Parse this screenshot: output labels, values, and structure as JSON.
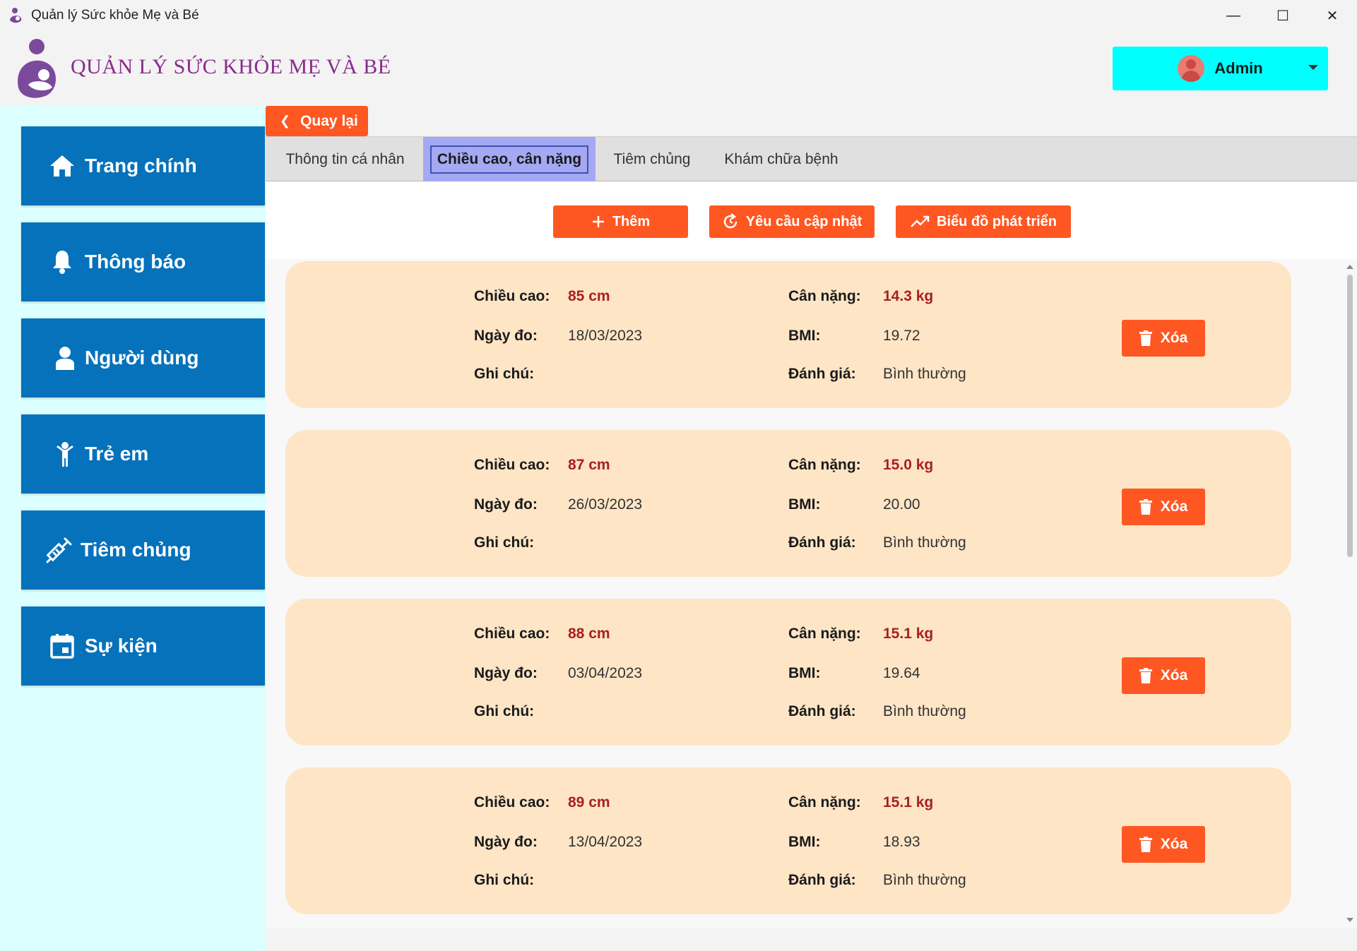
{
  "window": {
    "title": "Quản lý Sức khỏe Mẹ và Bé",
    "minimize": "—",
    "maximize": "☐",
    "close": "✕"
  },
  "header": {
    "brand": "QUẢN LÝ SỨC KHỎE MẸ VÀ BÉ",
    "user_name": "Admin"
  },
  "sidebar": {
    "items": [
      {
        "label": "Trang chính",
        "icon": "home-icon"
      },
      {
        "label": "Thông báo",
        "icon": "bell-icon"
      },
      {
        "label": "Người dùng",
        "icon": "user-icon"
      },
      {
        "label": "Trẻ em",
        "icon": "child-icon"
      },
      {
        "label": "Tiêm chủng",
        "icon": "syringe-icon"
      },
      {
        "label": "Sự kiện",
        "icon": "calendar-icon"
      }
    ]
  },
  "back_label": "Quay lại",
  "tabs": [
    {
      "label": "Thông tin cá nhân"
    },
    {
      "label": "Chiều cao, cân nặng"
    },
    {
      "label": "Tiêm chủng"
    },
    {
      "label": "Khám chữa bệnh"
    }
  ],
  "actions": {
    "add": "Thêm",
    "request_update": "Yêu cầu cập nhật",
    "growth_chart": "Biểu đồ phát triển"
  },
  "labels": {
    "height": "Chiều cao:",
    "weight": "Cân nặng:",
    "date": "Ngày đo:",
    "bmi": "BMI:",
    "note": "Ghi chú:",
    "assessment": "Đánh giá:",
    "delete": "Xóa"
  },
  "records": [
    {
      "height": "85 cm",
      "weight": "14.3 kg",
      "date": "18/03/2023",
      "bmi": "19.72",
      "note": "",
      "assessment": "Bình thường"
    },
    {
      "height": "87 cm",
      "weight": "15.0 kg",
      "date": "26/03/2023",
      "bmi": "20.00",
      "note": "",
      "assessment": "Bình thường"
    },
    {
      "height": "88 cm",
      "weight": "15.1 kg",
      "date": "03/04/2023",
      "bmi": "19.64",
      "note": "",
      "assessment": "Bình thường"
    },
    {
      "height": "89 cm",
      "weight": "15.1 kg",
      "date": "13/04/2023",
      "bmi": "18.93",
      "note": "",
      "assessment": "Bình thường"
    }
  ],
  "colors": {
    "accent": "#ff5722",
    "sidebar_item": "#0572bb",
    "sidebar_bg": "#dcffff",
    "card_bg": "#fde5c6",
    "highlight_value": "#a82020",
    "active_tab": "#a5a8f2",
    "user_button": "#00ffff",
    "brand": "#8a2b8c"
  }
}
